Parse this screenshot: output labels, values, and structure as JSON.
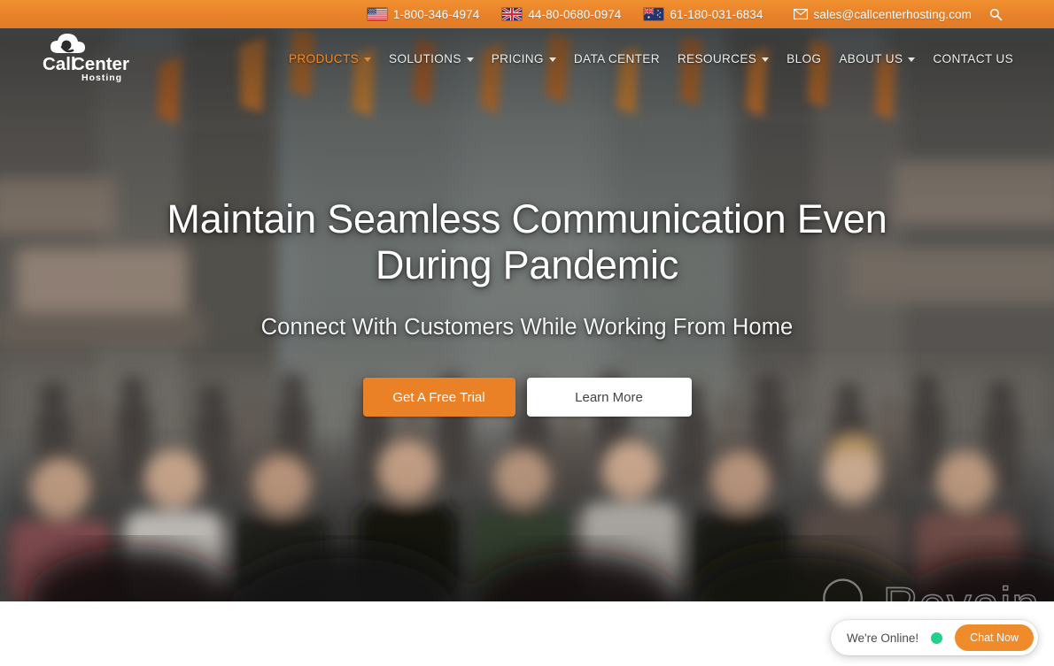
{
  "topbar": {
    "contacts": [
      {
        "icon": "us-flag-icon",
        "label": "1-800-346-4974"
      },
      {
        "icon": "uk-flag-icon",
        "label": "44-80-0680-0974"
      },
      {
        "icon": "au-flag-icon",
        "label": "61-180-031-6834"
      }
    ],
    "email": {
      "icon": "envelope-icon",
      "label": "sales@callcenterhosting.com"
    },
    "search_icon": "search-icon",
    "background_color": "#e8812a"
  },
  "logo": {
    "name_part1": "Call",
    "name_part2": "Center",
    "tagline": "Hosting",
    "icon": "cloud-headset-icon"
  },
  "nav": {
    "items": [
      {
        "label": "PRODUCTS",
        "has_dropdown": true,
        "active": true
      },
      {
        "label": "SOLUTIONS",
        "has_dropdown": true,
        "active": false
      },
      {
        "label": "PRICING",
        "has_dropdown": true,
        "active": false
      },
      {
        "label": "DATA CENTER",
        "has_dropdown": false,
        "active": false
      },
      {
        "label": "RESOURCES",
        "has_dropdown": true,
        "active": false
      },
      {
        "label": "BLOG",
        "has_dropdown": false,
        "active": false
      },
      {
        "label": "ABOUT US",
        "has_dropdown": true,
        "active": false
      },
      {
        "label": "CONTACT US",
        "has_dropdown": false,
        "active": false
      }
    ],
    "active_color": "#f08b2c"
  },
  "hero": {
    "headline": "Maintain Seamless Communication Even During Pandemic",
    "subheadline": "Connect With Customers While Working From Home",
    "primary_cta": "Get A Free Trial",
    "secondary_cta": "Learn More",
    "primary_cta_color": "#ea8126"
  },
  "watermark": {
    "text": "Revain",
    "logo_icon": "revain-q-logo-icon"
  },
  "chat_widget": {
    "status_text": "We're Online!",
    "status_color": "#1fd18a",
    "button_label": "Chat Now",
    "button_color": "#f08b2c"
  }
}
